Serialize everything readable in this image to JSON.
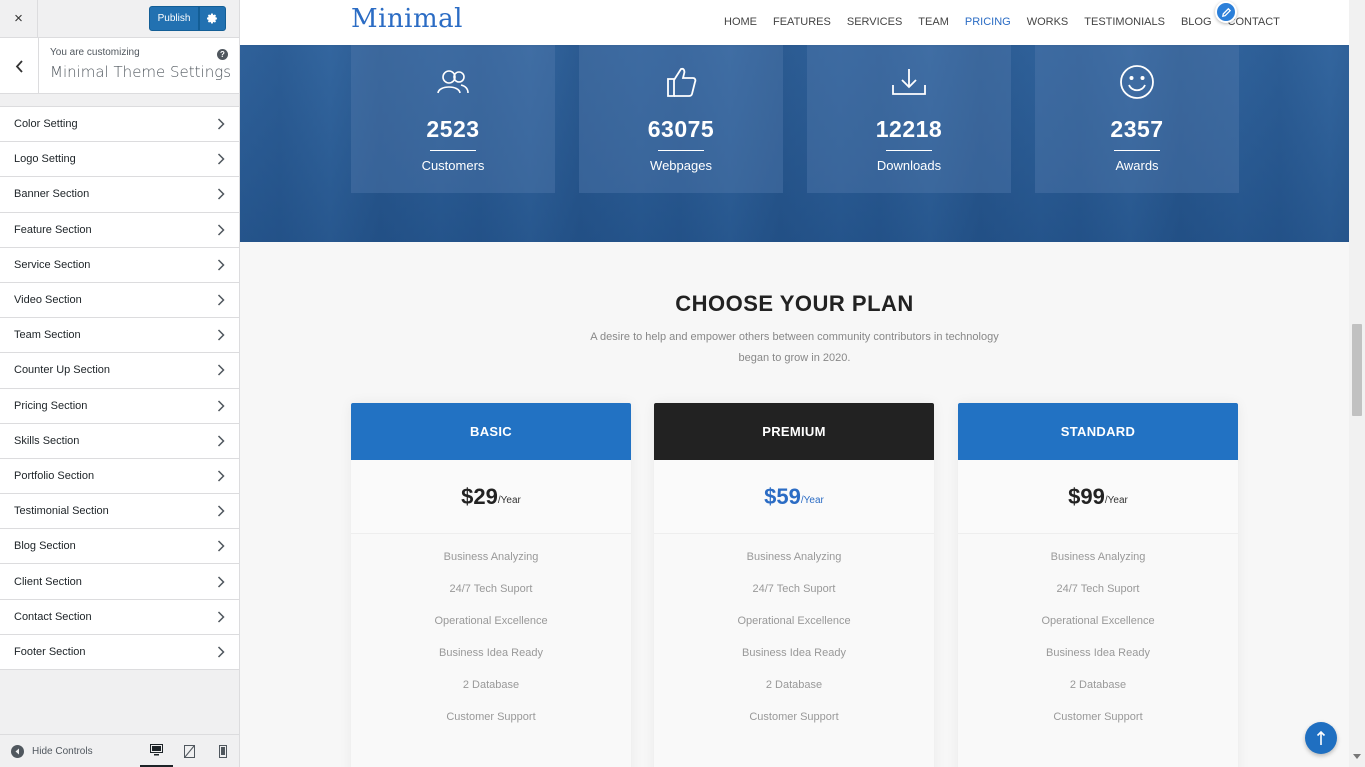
{
  "sidebar": {
    "close_label": "×",
    "publish_label": "Publish",
    "customizing_label": "You are customizing",
    "theme_name": "Minimal Theme Settings",
    "help_label": "?",
    "items": [
      {
        "label": "Color Setting"
      },
      {
        "label": "Logo Setting"
      },
      {
        "label": "Banner Section"
      },
      {
        "label": "Feature Section"
      },
      {
        "label": "Service Section"
      },
      {
        "label": "Video Section"
      },
      {
        "label": "Team Section"
      },
      {
        "label": "Counter Up Section"
      },
      {
        "label": "Pricing Section"
      },
      {
        "label": "Skills Section"
      },
      {
        "label": "Portfolio Section"
      },
      {
        "label": "Testimonial Section"
      },
      {
        "label": "Blog Section"
      },
      {
        "label": "Client Section"
      },
      {
        "label": "Contact Section"
      },
      {
        "label": "Footer Section"
      }
    ],
    "hide_controls_label": "Hide Controls",
    "devices": [
      "desktop-icon",
      "tablet-icon",
      "mobile-icon"
    ]
  },
  "site": {
    "logo": "Minimal",
    "nav": [
      "HOME",
      "FEATURES",
      "SERVICES",
      "TEAM",
      "PRICING",
      "WORKS",
      "TESTIMONIALS",
      "BLOG",
      "CONTACT"
    ],
    "active_nav": "PRICING",
    "accent_color": "#2b6cc4"
  },
  "counters": [
    {
      "value": "2523",
      "label": "Customers",
      "icon": "users-icon"
    },
    {
      "value": "63075",
      "label": "Webpages",
      "icon": "thumbs-up-icon"
    },
    {
      "value": "12218",
      "label": "Downloads",
      "icon": "download-icon"
    },
    {
      "value": "2357",
      "label": "Awards",
      "icon": "smiley-icon"
    }
  ],
  "pricing": {
    "title": "CHOOSE YOUR PLAN",
    "desc_line1": "A desire to help and empower others between community contributors in technology",
    "desc_line2": "began to grow in 2020.",
    "plans": [
      {
        "name": "BASIC",
        "price": "$29",
        "per": "/Year",
        "header_color": "#2272c3",
        "features": [
          "Business Analyzing",
          "24/7 Tech Suport",
          "Operational Excellence",
          "Business Idea Ready",
          "2 Database",
          "Customer Support"
        ]
      },
      {
        "name": "PREMIUM",
        "price": "$59",
        "per": "/Year",
        "header_color": "#222222",
        "features": [
          "Business Analyzing",
          "24/7 Tech Suport",
          "Operational Excellence",
          "Business Idea Ready",
          "2 Database",
          "Customer Support"
        ]
      },
      {
        "name": "STANDARD",
        "price": "$99",
        "per": "/Year",
        "header_color": "#2272c3",
        "features": [
          "Business Analyzing",
          "24/7 Tech Suport",
          "Operational Excellence",
          "Business Idea Ready",
          "2 Database",
          "Customer Support"
        ]
      }
    ]
  }
}
